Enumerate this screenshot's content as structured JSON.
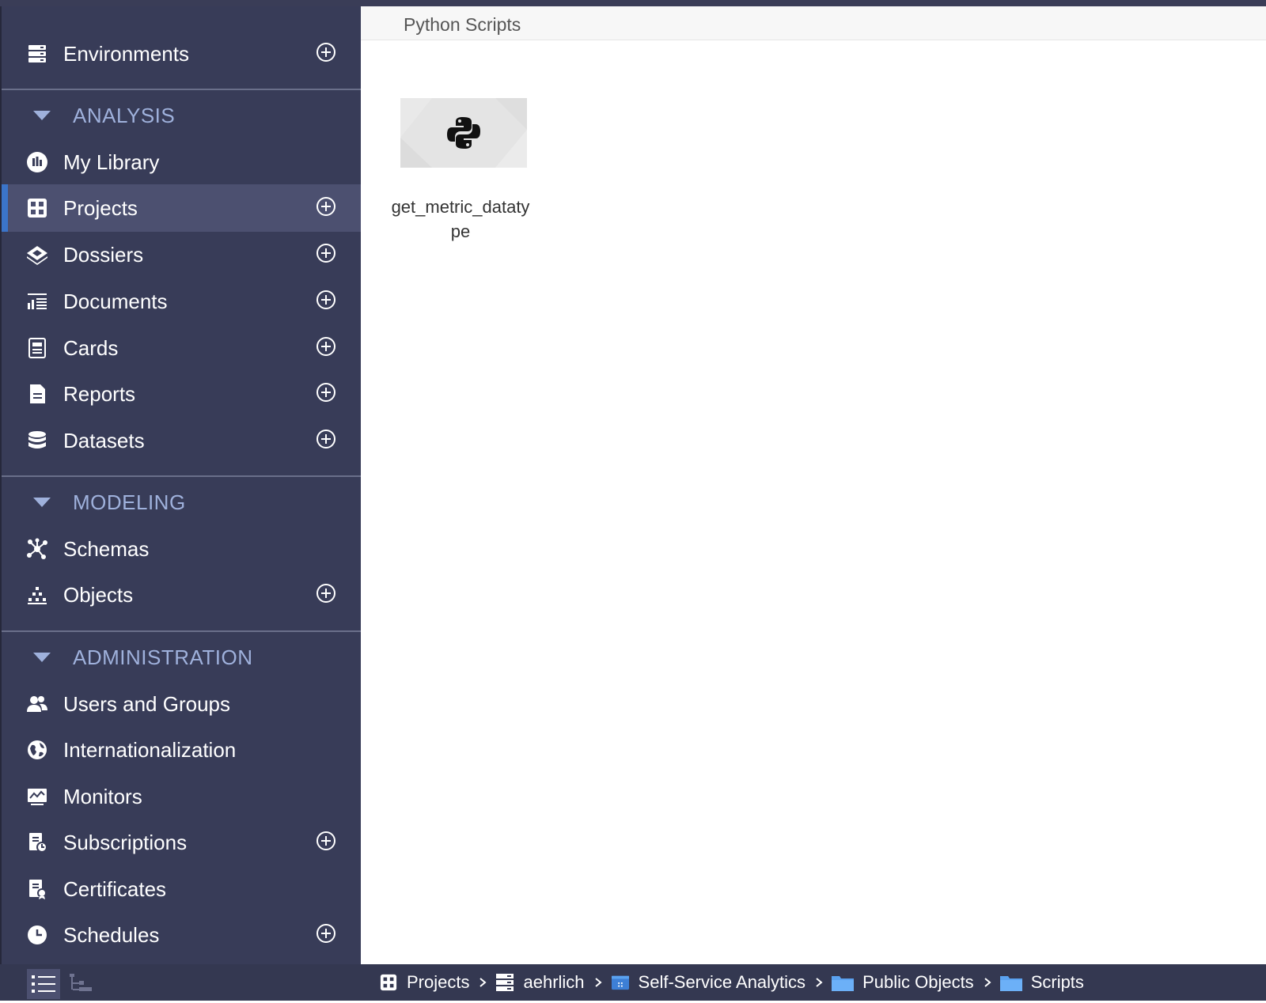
{
  "sidebar": {
    "top_item": {
      "label": "Environments",
      "icon": "server-stack-icon",
      "has_add": true
    },
    "sections": [
      {
        "title": "ANALYSIS",
        "items": [
          {
            "label": "My Library",
            "icon": "library-chart-icon",
            "has_add": false
          },
          {
            "label": "Projects",
            "icon": "projects-grid-icon",
            "has_add": true,
            "active": true
          },
          {
            "label": "Dossiers",
            "icon": "dossier-layers-icon",
            "has_add": true
          },
          {
            "label": "Documents",
            "icon": "document-chart-icon",
            "has_add": true
          },
          {
            "label": "Cards",
            "icon": "card-icon",
            "has_add": true
          },
          {
            "label": "Reports",
            "icon": "report-file-icon",
            "has_add": true
          },
          {
            "label": "Datasets",
            "icon": "database-icon",
            "has_add": true
          }
        ]
      },
      {
        "title": "MODELING",
        "items": [
          {
            "label": "Schemas",
            "icon": "schema-nodes-icon",
            "has_add": false
          },
          {
            "label": "Objects",
            "icon": "objects-pyramid-icon",
            "has_add": true
          }
        ]
      },
      {
        "title": "ADMINISTRATION",
        "items": [
          {
            "label": "Users and Groups",
            "icon": "users-icon",
            "has_add": false
          },
          {
            "label": "Internationalization",
            "icon": "globe-icon",
            "has_add": false
          },
          {
            "label": "Monitors",
            "icon": "monitor-icon",
            "has_add": false
          },
          {
            "label": "Subscriptions",
            "icon": "subscription-icon",
            "has_add": true
          },
          {
            "label": "Certificates",
            "icon": "certificate-icon",
            "has_add": false
          },
          {
            "label": "Schedules",
            "icon": "clock-icon",
            "has_add": true
          }
        ]
      }
    ]
  },
  "main": {
    "header_title": "Python Scripts",
    "files": [
      {
        "name": "get_metric_datatype",
        "icon": "python-icon"
      }
    ]
  },
  "statusbar": {
    "view_modes": [
      "list-view-icon",
      "tree-view-icon"
    ],
    "breadcrumb": [
      {
        "label": "Projects",
        "icon": "projects-grid-icon"
      },
      {
        "label": "aehrlich",
        "icon": "server-stack-icon"
      },
      {
        "label": "Self-Service Analytics",
        "icon": "project-box-icon"
      },
      {
        "label": "Public Objects",
        "icon": "folder-icon"
      },
      {
        "label": "Scripts",
        "icon": "folder-icon"
      }
    ]
  },
  "colors": {
    "sidebar_bg": "#383c58",
    "sidebar_active": "#4c5070",
    "active_accent": "#3b74c9",
    "section_title": "#9fb1dc",
    "statusbar_bg": "#343851",
    "folder_blue": "#5aa2f0"
  }
}
